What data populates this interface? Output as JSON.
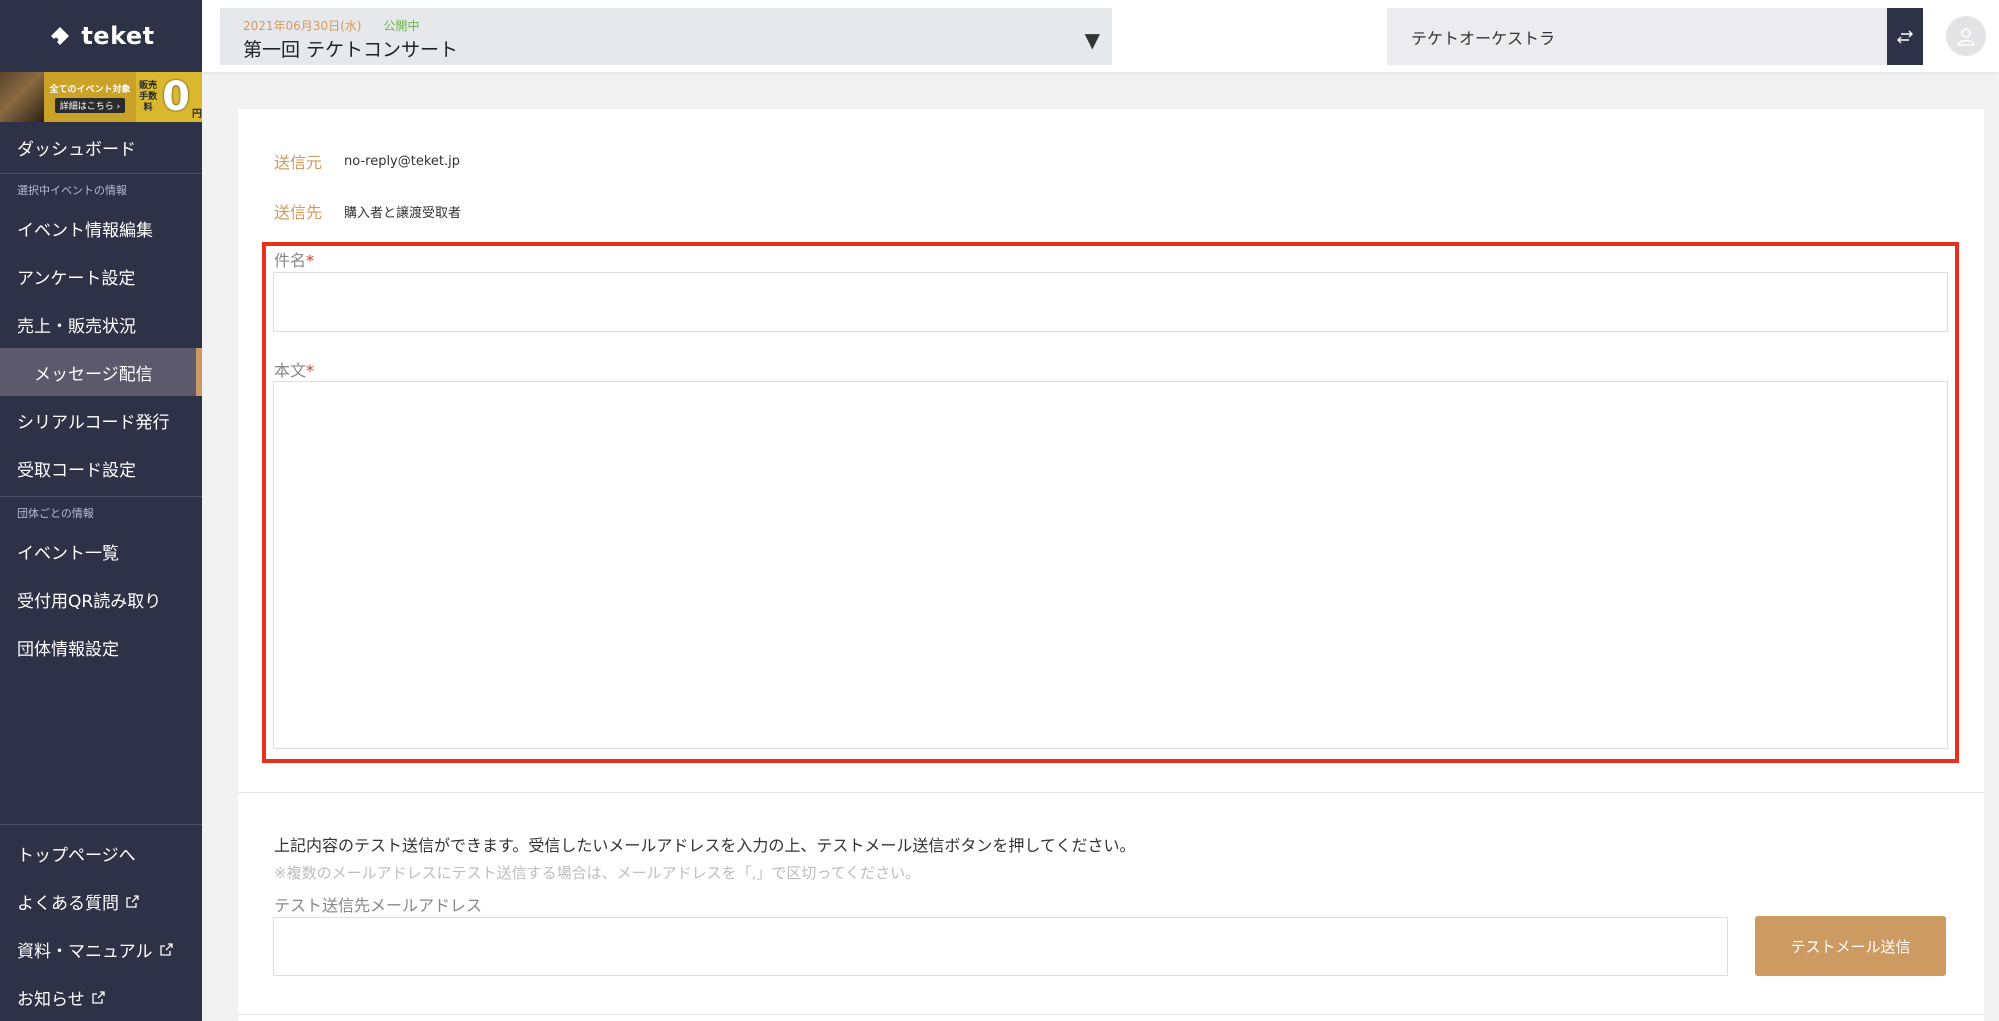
{
  "brand": {
    "name": "teket"
  },
  "banner": {
    "line1": "全てのイベント対象",
    "line2": "詳細はこちら ›",
    "fee": "販売手数料",
    "zero": "0",
    "yen": "円"
  },
  "sidebar": {
    "dashboard": "ダッシュボード",
    "section_event": "選択中イベントの情報",
    "event_items": [
      {
        "label": "イベント情報編集"
      },
      {
        "label": "アンケート設定"
      },
      {
        "label": "売上・販売状況"
      },
      {
        "label": "メッセージ配信",
        "active": true
      },
      {
        "label": "シリアルコード発行"
      },
      {
        "label": "受取コード設定"
      }
    ],
    "section_org": "団体ごとの情報",
    "org_items": [
      {
        "label": "イベント一覧"
      },
      {
        "label": "受付用QR読み取り"
      },
      {
        "label": "団体情報設定"
      }
    ],
    "bottom_items": [
      {
        "label": "トップページへ",
        "external": false
      },
      {
        "label": "よくある質問",
        "external": true
      },
      {
        "label": "資料・マニュアル",
        "external": true
      },
      {
        "label": "お知らせ",
        "external": true
      }
    ]
  },
  "header": {
    "event_date": "2021年06月30日(水)",
    "event_status": "公開中",
    "event_name": "第一回 テケトコンサート",
    "caret": "▼",
    "org_name": "テケトオーケストラ"
  },
  "form": {
    "from_label": "送信元",
    "from_value": "no-reply@teket.jp",
    "to_label": "送信先",
    "to_value": "購入者と譲渡受取者",
    "subject_label": "件名",
    "subject_value": "",
    "body_label": "本文",
    "body_value": "",
    "required_mark": "*"
  },
  "test": {
    "description": "上記内容のテスト送信ができます。受信したいメールアドレスを入力の上、テストメール送信ボタンを押してください。",
    "note": "※複数のメールアドレスにテスト送信する場合は、メールアドレスを「,」で区切ってください。",
    "address_label": "テスト送信先メールアドレス",
    "address_value": "",
    "button_label": "テストメール送信"
  },
  "colors": {
    "sidebar_bg": "#2e3247",
    "accent": "#cd9a62",
    "highlight": "#e8301c",
    "status_green": "#6ab34a"
  }
}
